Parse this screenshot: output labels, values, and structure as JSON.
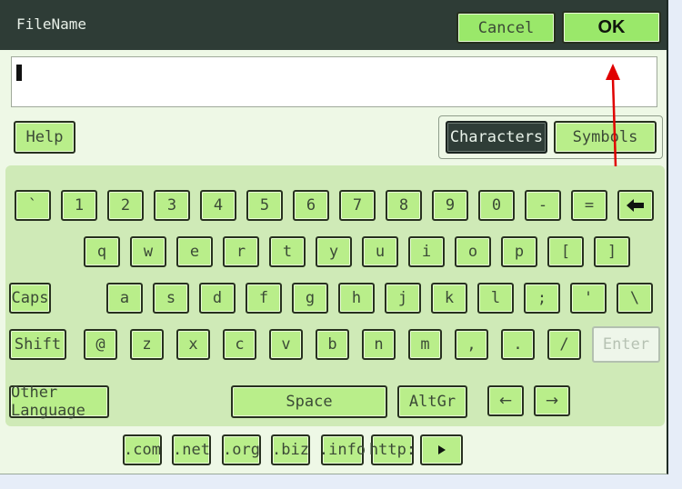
{
  "title": "FileName",
  "buttons": {
    "cancel": "Cancel",
    "ok": "OK",
    "help": "Help"
  },
  "input": {
    "value": ""
  },
  "modes": {
    "characters": "Characters",
    "symbols": "Symbols"
  },
  "rows": {
    "row1": [
      "`",
      "1",
      "2",
      "3",
      "4",
      "5",
      "6",
      "7",
      "8",
      "9",
      "0",
      "-",
      "="
    ],
    "row2": [
      "q",
      "w",
      "e",
      "r",
      "t",
      "y",
      "u",
      "i",
      "o",
      "p",
      "[",
      "]"
    ],
    "row3": [
      "a",
      "s",
      "d",
      "f",
      "g",
      "h",
      "j",
      "k",
      "l",
      ";",
      "'",
      "\\"
    ],
    "row4": [
      "@",
      "z",
      "x",
      "c",
      "v",
      "b",
      "n",
      "m",
      ",",
      ".",
      "/"
    ]
  },
  "special": {
    "caps": "Caps",
    "shift": "Shift",
    "enter": "Enter",
    "other_language": "Other Language",
    "space": "Space",
    "altgr": "AltGr"
  },
  "icons": {
    "backspace": "backspace-icon",
    "left": "arrow-left-icon",
    "right": "arrow-right-icon",
    "next": "play-icon"
  },
  "arrows": {
    "left": "←",
    "right": "→"
  },
  "shortcuts": [
    ".com",
    ".net",
    ".org",
    ".biz",
    ".info",
    "http:"
  ],
  "colors": {
    "key": "#b9ee8a",
    "panel": "#cfeab7",
    "titlebar": "#2e3c36",
    "annotation": "#e00000"
  }
}
